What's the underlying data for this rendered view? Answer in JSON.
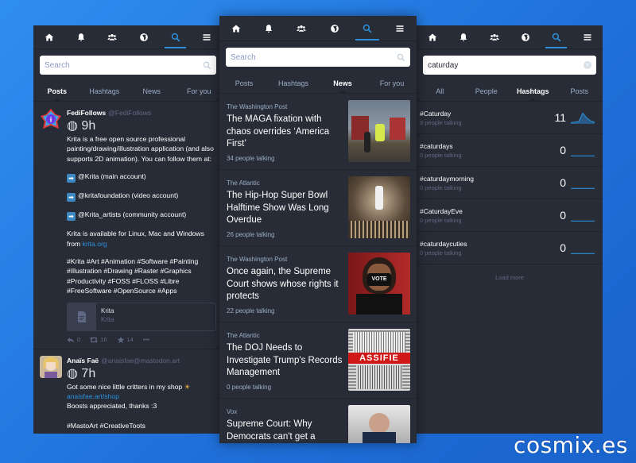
{
  "left": {
    "search": {
      "placeholder": "Search"
    },
    "tabs": [
      "Posts",
      "Hashtags",
      "News",
      "For you"
    ],
    "posts": [
      {
        "display_name": "FediFollows",
        "acct": "@FediFollows",
        "time": "9h",
        "p1": "Krita is a free open source professional painting/drawing/illustration application (and also supports 2D animation). You can follow them at:",
        "bullets": [
          "@Krita (main account)",
          "@kritafoundation (video account)",
          "@Krita_artists (community account)"
        ],
        "p2_prefix": "Krita is available for Linux, Mac and Windows from ",
        "p2_link": "krita.org",
        "p3": "#Krita #Art #Animation #Software #Painting #Illustration #Drawing #Raster #Graphics #Productivity #FOSS #FLOSS #Libre #FreeSoftware #OpenSource #Apps",
        "card_title": "Krita",
        "card_sub": "Krita",
        "replies": "0",
        "boosts": "16",
        "favs": "14",
        "more": "•••"
      },
      {
        "display_name": "Anaïs Faë",
        "acct": "@anaisfae@mastodon.art",
        "time": "7h",
        "line1": "Got some nice little critters in my shop",
        "link": "anaisfae.art/shop",
        "line3": "Boosts appreciated, thanks :3",
        "tags": "#MastoArt #CreativeToots"
      }
    ]
  },
  "center": {
    "search": {
      "placeholder": "Search"
    },
    "tabs": [
      "Posts",
      "Hashtags",
      "News",
      "For you"
    ],
    "news": [
      {
        "source": "The Washington Post",
        "title": "The MAGA fixation with chaos overrides ‘America First’",
        "talking": "34 people talking"
      },
      {
        "source": "The Atlantic",
        "title": "The Hip-Hop Super Bowl Halftime Show Was Long Overdue",
        "talking": "26 people talking"
      },
      {
        "source": "The Washington Post",
        "title": "Once again, the Supreme Court shows whose rights it protects",
        "talking": "22 people talking"
      },
      {
        "source": "The Atlantic",
        "title": "The DOJ Needs to Investigate Trump's Records Management",
        "talking": "0 people talking"
      },
      {
        "source": "Vox",
        "title": "Supreme Court: Why Democrats can't get a",
        "talking": ""
      }
    ],
    "thumb_texts": {
      "vote": "VOTE",
      "classified": "ASSIFIE"
    }
  },
  "right": {
    "search": {
      "value": "caturday"
    },
    "tabs": [
      "All",
      "People",
      "Hashtags",
      "Posts"
    ],
    "hashtags": [
      {
        "name": "#Caturday",
        "uses": "9 people talking",
        "count": "11",
        "trend": [
          0.1,
          0.15,
          0.2,
          0.9,
          0.5,
          0.25,
          0.15
        ]
      },
      {
        "name": "#caturdays",
        "uses": "0 people talking",
        "count": "0",
        "trend": [
          0.05,
          0.05,
          0.05,
          0.05,
          0.05,
          0.05,
          0.05
        ]
      },
      {
        "name": "#caturdaymorning",
        "uses": "0 people talking",
        "count": "0",
        "trend": [
          0.05,
          0.05,
          0.05,
          0.05,
          0.05,
          0.05,
          0.05
        ]
      },
      {
        "name": "#CaturdayEve",
        "uses": "0 people talking",
        "count": "0",
        "trend": [
          0.05,
          0.05,
          0.05,
          0.05,
          0.05,
          0.05,
          0.05
        ]
      },
      {
        "name": "#caturdaycuties",
        "uses": "0 people talking",
        "count": "0",
        "trend": [
          0.05,
          0.05,
          0.05,
          0.05,
          0.05,
          0.05,
          0.05
        ]
      }
    ],
    "load_more": "Load more"
  },
  "nav_icons": [
    "home-icon",
    "bell-icon",
    "people-icon",
    "globe-icon",
    "search-icon",
    "menu-icon"
  ],
  "colors": {
    "panel": "#282c37",
    "accent": "#2b90d9",
    "muted": "#606984",
    "secondary": "#9baec8",
    "background": "#2b88ec"
  },
  "watermark": "cosmix.es"
}
